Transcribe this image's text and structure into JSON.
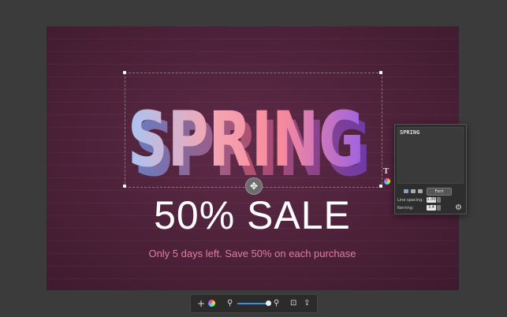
{
  "canvas": {
    "headline": "SPRING",
    "sale_text": "50% SALE",
    "subtitle": "Only 5 days left. Save 50% on each purchase"
  },
  "text_panel": {
    "text_value": "SPRING",
    "font_button": "Font",
    "line_spacing_label": "Line spacing:",
    "line_spacing_value": "1.00",
    "kerning_label": "Kerning:",
    "kerning_value": "3.4"
  },
  "overlay_icons": {
    "text_tool": "T",
    "transform": "move-rotate-icon"
  },
  "toolbar": {
    "add": "+",
    "zoom_out": "zoom-out-icon",
    "zoom_in": "zoom-in-icon",
    "zoom_level": 0.85
  },
  "colors": {
    "background": "#3b3b3b",
    "canvas": "#4d2139",
    "subtitle": "#e27a9e",
    "accent": "#3a8de3"
  }
}
